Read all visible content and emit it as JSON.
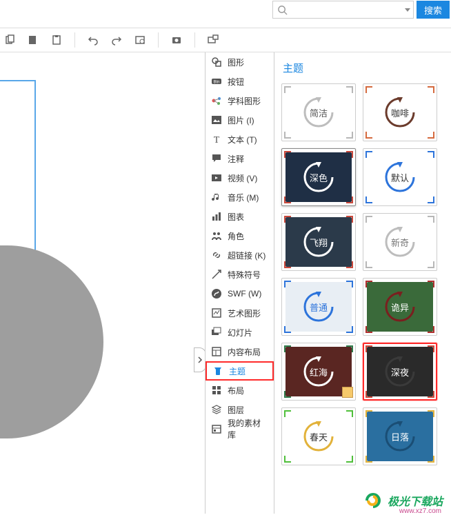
{
  "search": {
    "placeholder": "",
    "button_label": "搜索"
  },
  "toolbar_icons": [
    "copy",
    "paste",
    "clipboard",
    "sep",
    "undo",
    "redo",
    "history",
    "sep",
    "camera",
    "sep",
    "fullscreen"
  ],
  "menu": [
    {
      "icon": "shapes",
      "label": "图形"
    },
    {
      "icon": "btn",
      "label": "按钮"
    },
    {
      "icon": "subject",
      "label": "学科图形"
    },
    {
      "icon": "image",
      "label": "图片 (I)"
    },
    {
      "icon": "text",
      "label": "文本 (T)"
    },
    {
      "icon": "comment",
      "label": "注释"
    },
    {
      "icon": "video",
      "label": "视频 (V)"
    },
    {
      "icon": "music",
      "label": "音乐 (M)"
    },
    {
      "icon": "chart",
      "label": "图表"
    },
    {
      "icon": "people",
      "label": "角色"
    },
    {
      "icon": "link",
      "label": "超链接 (K)"
    },
    {
      "icon": "special",
      "label": "特殊符号"
    },
    {
      "icon": "swf",
      "label": "SWF (W)"
    },
    {
      "icon": "art",
      "label": "艺术图形"
    },
    {
      "icon": "slides",
      "label": "幻灯片"
    },
    {
      "icon": "layout",
      "label": "内容布局"
    },
    {
      "icon": "theme",
      "label": "主题",
      "active": true
    },
    {
      "icon": "grid",
      "label": "布局"
    },
    {
      "icon": "layers",
      "label": "图层"
    },
    {
      "icon": "library",
      "label": "我的素材库"
    }
  ],
  "panel": {
    "title": "主题",
    "themes": [
      {
        "label": "简洁",
        "bg": "#ffffff",
        "corner": "#b7b7b7",
        "arc": "#bdbdbd",
        "text": "#555"
      },
      {
        "label": "咖啡",
        "bg": "#ffffff",
        "corner": "#d56a3e",
        "arc": "#6b3b2c",
        "text": "#333"
      },
      {
        "label": "深色",
        "bg": "#1f2f45",
        "corner": "#c9483b",
        "arc": "#ffffff",
        "text": "#fff",
        "hover": true
      },
      {
        "label": "默认",
        "bg": "#ffffff",
        "corner": "#2d74db",
        "arc": "#2d74db",
        "text": "#333"
      },
      {
        "label": "飞翔",
        "bg": "#2b3a4a",
        "corner": "#c9483b",
        "arc": "#ffffff",
        "text": "#fff"
      },
      {
        "label": "新奇",
        "bg": "#ffffff",
        "corner": "#b7b7b7",
        "arc": "#bdbdbd",
        "text": "#777"
      },
      {
        "label": "普通",
        "bg": "#e8eef4",
        "corner": "#2d74db",
        "arc": "#2d74db",
        "text": "#2d74db"
      },
      {
        "label": "诡异",
        "bg": "#3a6a3a",
        "corner": "#b03030",
        "arc": "#7a1f1f",
        "text": "#fff"
      },
      {
        "label": "红海",
        "bg": "#5a2622",
        "corner": "#2e7a4a",
        "arc": "#ffffff",
        "text": "#fff",
        "badge": true
      },
      {
        "label": "深夜",
        "bg": "#2a2a2a",
        "corner": "#c9483b",
        "arc": "#3a3a3a",
        "text": "#fff",
        "selected": true
      },
      {
        "label": "春天",
        "bg": "#ffffff",
        "corner": "#4fbf3a",
        "arc": "#e2b23a",
        "text": "#333"
      },
      {
        "label": "日落",
        "bg": "#2a6fa0",
        "corner": "#e2b23a",
        "arc": "#1a4e75",
        "text": "#fff"
      }
    ]
  },
  "watermark": {
    "brand": "极光下载站",
    "url": "www.xz7.com"
  }
}
